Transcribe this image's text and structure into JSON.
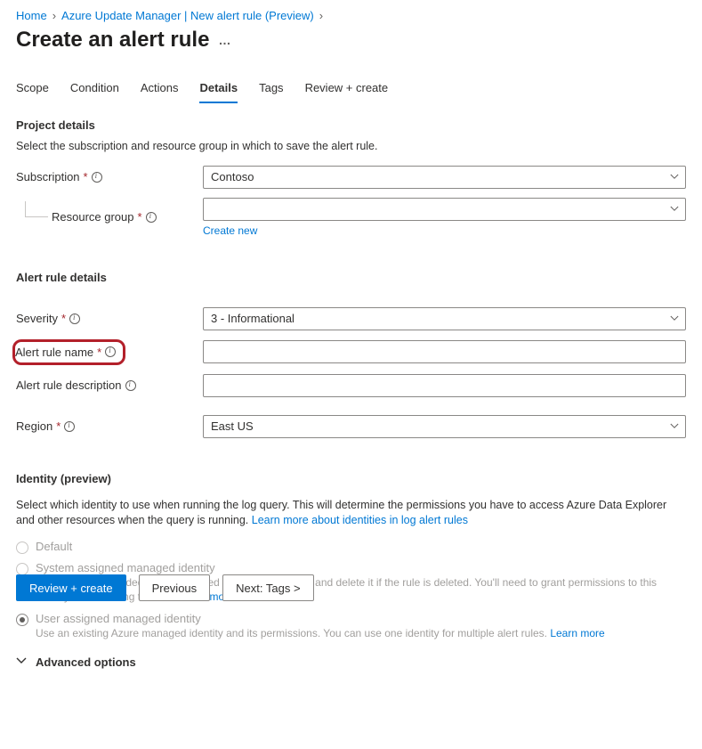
{
  "breadcrumb": {
    "item1": "Home",
    "item2": "Azure Update Manager | New alert rule (Preview)"
  },
  "page_title": "Create an alert rule",
  "tabs": {
    "scope": "Scope",
    "condition": "Condition",
    "actions": "Actions",
    "details": "Details",
    "tags": "Tags",
    "review": "Review + create"
  },
  "project_details": {
    "heading": "Project details",
    "desc": "Select the subscription and resource group in which to save the alert rule.",
    "subscription_label": "Subscription",
    "subscription_value": "Contoso",
    "resource_group_label": "Resource group",
    "resource_group_value": "",
    "create_new": "Create new"
  },
  "alert_rule_details": {
    "heading": "Alert rule details",
    "severity_label": "Severity",
    "severity_value": "3 - Informational",
    "name_label": "Alert rule name",
    "name_value": "",
    "desc_label": "Alert rule description",
    "desc_value": "",
    "region_label": "Region",
    "region_value": "East US"
  },
  "identity": {
    "heading": "Identity (preview)",
    "desc_part1": "Select which identity to use when running the log query. This will determine the permissions you have to access Azure Data Explorer and other resources when the query is running. ",
    "learn_more": "Learn more about identities in log alert rules",
    "opt_default": "Default",
    "opt_system": "System assigned managed identity",
    "opt_system_sub_part1": "Azure will create a dedicated managed identity for this rule and delete it if the rule is deleted. You'll need to grant permissions to this identity after creating the rule. ",
    "opt_system_learn": "Learn more",
    "opt_user": "User assigned managed identity",
    "opt_user_sub_part1": "Use an existing Azure managed identity and its permissions. You can use one identity for multiple alert rules. ",
    "opt_user_learn": "Learn more"
  },
  "advanced": {
    "label": "Advanced options"
  },
  "footer": {
    "review": "Review + create",
    "previous": "Previous",
    "next": "Next: Tags >"
  }
}
